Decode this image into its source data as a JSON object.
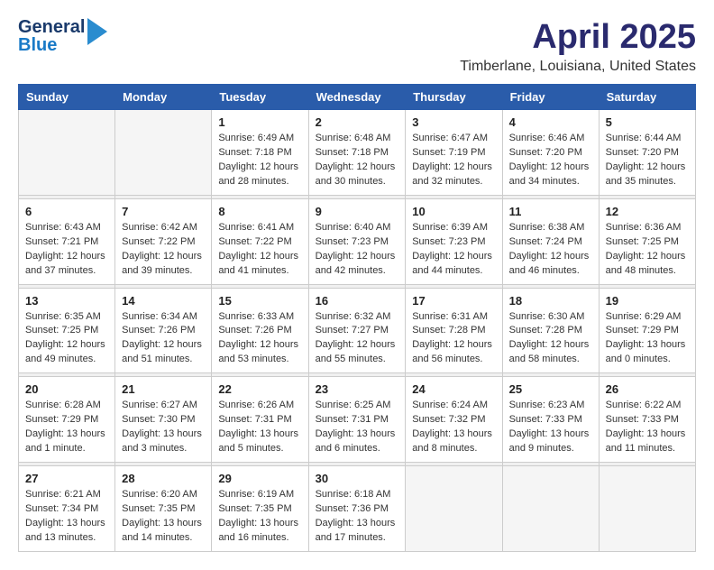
{
  "header": {
    "logo_general": "General",
    "logo_blue": "Blue",
    "title": "April 2025",
    "subtitle": "Timberlane, Louisiana, United States"
  },
  "calendar": {
    "days_of_week": [
      "Sunday",
      "Monday",
      "Tuesday",
      "Wednesday",
      "Thursday",
      "Friday",
      "Saturday"
    ],
    "weeks": [
      [
        {
          "day": "",
          "info": ""
        },
        {
          "day": "",
          "info": ""
        },
        {
          "day": "1",
          "info": "Sunrise: 6:49 AM\nSunset: 7:18 PM\nDaylight: 12 hours\nand 28 minutes."
        },
        {
          "day": "2",
          "info": "Sunrise: 6:48 AM\nSunset: 7:18 PM\nDaylight: 12 hours\nand 30 minutes."
        },
        {
          "day": "3",
          "info": "Sunrise: 6:47 AM\nSunset: 7:19 PM\nDaylight: 12 hours\nand 32 minutes."
        },
        {
          "day": "4",
          "info": "Sunrise: 6:46 AM\nSunset: 7:20 PM\nDaylight: 12 hours\nand 34 minutes."
        },
        {
          "day": "5",
          "info": "Sunrise: 6:44 AM\nSunset: 7:20 PM\nDaylight: 12 hours\nand 35 minutes."
        }
      ],
      [
        {
          "day": "6",
          "info": "Sunrise: 6:43 AM\nSunset: 7:21 PM\nDaylight: 12 hours\nand 37 minutes."
        },
        {
          "day": "7",
          "info": "Sunrise: 6:42 AM\nSunset: 7:22 PM\nDaylight: 12 hours\nand 39 minutes."
        },
        {
          "day": "8",
          "info": "Sunrise: 6:41 AM\nSunset: 7:22 PM\nDaylight: 12 hours\nand 41 minutes."
        },
        {
          "day": "9",
          "info": "Sunrise: 6:40 AM\nSunset: 7:23 PM\nDaylight: 12 hours\nand 42 minutes."
        },
        {
          "day": "10",
          "info": "Sunrise: 6:39 AM\nSunset: 7:23 PM\nDaylight: 12 hours\nand 44 minutes."
        },
        {
          "day": "11",
          "info": "Sunrise: 6:38 AM\nSunset: 7:24 PM\nDaylight: 12 hours\nand 46 minutes."
        },
        {
          "day": "12",
          "info": "Sunrise: 6:36 AM\nSunset: 7:25 PM\nDaylight: 12 hours\nand 48 minutes."
        }
      ],
      [
        {
          "day": "13",
          "info": "Sunrise: 6:35 AM\nSunset: 7:25 PM\nDaylight: 12 hours\nand 49 minutes."
        },
        {
          "day": "14",
          "info": "Sunrise: 6:34 AM\nSunset: 7:26 PM\nDaylight: 12 hours\nand 51 minutes."
        },
        {
          "day": "15",
          "info": "Sunrise: 6:33 AM\nSunset: 7:26 PM\nDaylight: 12 hours\nand 53 minutes."
        },
        {
          "day": "16",
          "info": "Sunrise: 6:32 AM\nSunset: 7:27 PM\nDaylight: 12 hours\nand 55 minutes."
        },
        {
          "day": "17",
          "info": "Sunrise: 6:31 AM\nSunset: 7:28 PM\nDaylight: 12 hours\nand 56 minutes."
        },
        {
          "day": "18",
          "info": "Sunrise: 6:30 AM\nSunset: 7:28 PM\nDaylight: 12 hours\nand 58 minutes."
        },
        {
          "day": "19",
          "info": "Sunrise: 6:29 AM\nSunset: 7:29 PM\nDaylight: 13 hours\nand 0 minutes."
        }
      ],
      [
        {
          "day": "20",
          "info": "Sunrise: 6:28 AM\nSunset: 7:29 PM\nDaylight: 13 hours\nand 1 minute."
        },
        {
          "day": "21",
          "info": "Sunrise: 6:27 AM\nSunset: 7:30 PM\nDaylight: 13 hours\nand 3 minutes."
        },
        {
          "day": "22",
          "info": "Sunrise: 6:26 AM\nSunset: 7:31 PM\nDaylight: 13 hours\nand 5 minutes."
        },
        {
          "day": "23",
          "info": "Sunrise: 6:25 AM\nSunset: 7:31 PM\nDaylight: 13 hours\nand 6 minutes."
        },
        {
          "day": "24",
          "info": "Sunrise: 6:24 AM\nSunset: 7:32 PM\nDaylight: 13 hours\nand 8 minutes."
        },
        {
          "day": "25",
          "info": "Sunrise: 6:23 AM\nSunset: 7:33 PM\nDaylight: 13 hours\nand 9 minutes."
        },
        {
          "day": "26",
          "info": "Sunrise: 6:22 AM\nSunset: 7:33 PM\nDaylight: 13 hours\nand 11 minutes."
        }
      ],
      [
        {
          "day": "27",
          "info": "Sunrise: 6:21 AM\nSunset: 7:34 PM\nDaylight: 13 hours\nand 13 minutes."
        },
        {
          "day": "28",
          "info": "Sunrise: 6:20 AM\nSunset: 7:35 PM\nDaylight: 13 hours\nand 14 minutes."
        },
        {
          "day": "29",
          "info": "Sunrise: 6:19 AM\nSunset: 7:35 PM\nDaylight: 13 hours\nand 16 minutes."
        },
        {
          "day": "30",
          "info": "Sunrise: 6:18 AM\nSunset: 7:36 PM\nDaylight: 13 hours\nand 17 minutes."
        },
        {
          "day": "",
          "info": ""
        },
        {
          "day": "",
          "info": ""
        },
        {
          "day": "",
          "info": ""
        }
      ]
    ]
  }
}
